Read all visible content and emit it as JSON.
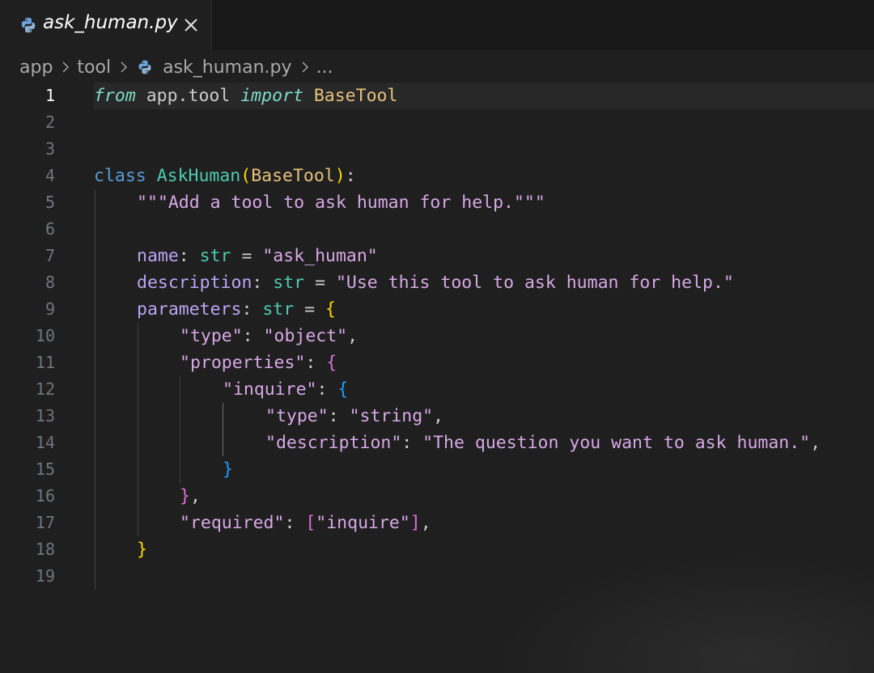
{
  "tab": {
    "title": "ask_human.py",
    "icon": "python-icon",
    "close_icon": "close-icon"
  },
  "breadcrumb": {
    "items": [
      "app",
      "tool",
      "ask_human.py",
      "..."
    ]
  },
  "editor": {
    "active_line": 1,
    "line_numbers": [
      "1",
      "2",
      "3",
      "4",
      "5",
      "6",
      "7",
      "8",
      "9",
      "10",
      "11",
      "12",
      "13",
      "14",
      "15",
      "16",
      "17",
      "18",
      "19"
    ],
    "code": {
      "l1": {
        "from": "from",
        "mod": " app.tool ",
        "import": "import",
        "name": " BaseTool"
      },
      "l4": {
        "class": "class",
        "sp": " ",
        "cls": "AskHuman",
        "po": "(",
        "base": "BaseTool",
        "pc": ")",
        "colon": ":"
      },
      "l5": {
        "doc": "\"\"\"Add a tool to ask human for help.\"\"\""
      },
      "l7": {
        "attr": "name",
        "colon": ": ",
        "type": "str",
        "eq": " = ",
        "val": "\"ask_human\""
      },
      "l8": {
        "attr": "description",
        "colon": ": ",
        "type": "str",
        "eq": " = ",
        "val": "\"Use this tool to ask human for help.\""
      },
      "l9": {
        "attr": "parameters",
        "colon": ": ",
        "type": "str",
        "eq": " = ",
        "brace": "{"
      },
      "l10": {
        "key": "\"type\"",
        "colon": ": ",
        "val": "\"object\"",
        "comma": ","
      },
      "l11": {
        "key": "\"properties\"",
        "colon": ": ",
        "brace": "{"
      },
      "l12": {
        "key": "\"inquire\"",
        "colon": ": ",
        "brace": "{"
      },
      "l13": {
        "key": "\"type\"",
        "colon": ": ",
        "val": "\"string\"",
        "comma": ","
      },
      "l14": {
        "key": "\"description\"",
        "colon": ": ",
        "val": "\"The question you want to ask human.\"",
        "comma": ","
      },
      "l15": {
        "brace": "}"
      },
      "l16": {
        "brace": "}",
        "comma": ","
      },
      "l17": {
        "key": "\"required\"",
        "colon": ": ",
        "bo": "[",
        "val": "\"inquire\"",
        "bc": "]",
        "comma": ","
      },
      "l18": {
        "brace": "}"
      }
    }
  },
  "colors": {
    "background": "#1f1f1f",
    "keyword": "#569cd6",
    "string": "#d7a8e6",
    "class": "#4ec9b0"
  }
}
